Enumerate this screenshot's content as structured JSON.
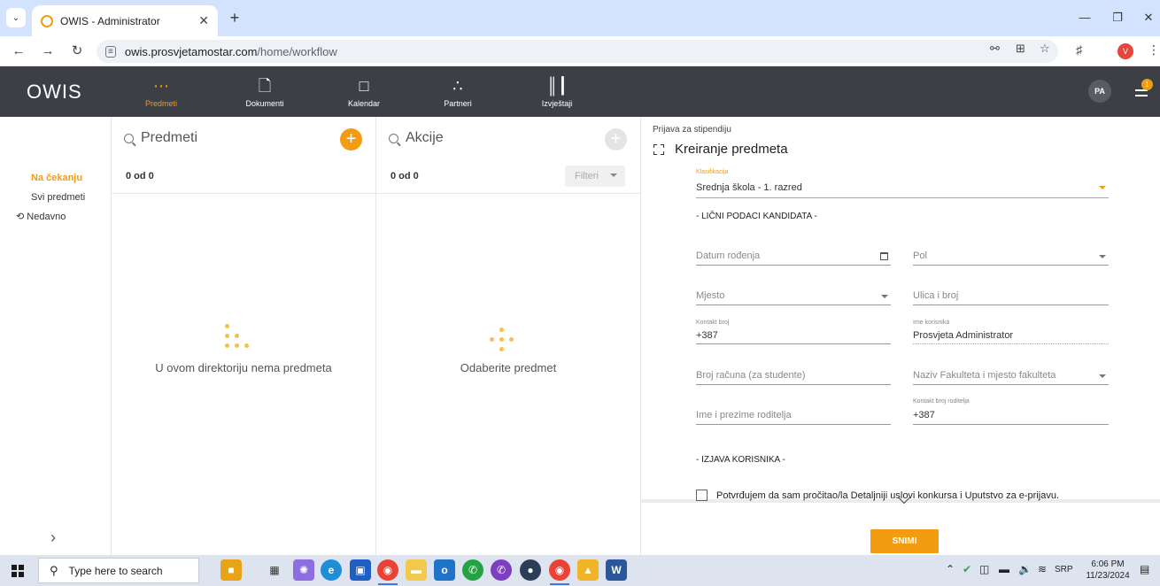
{
  "browser": {
    "tab_title": "OWIS - Administrator",
    "url_host": "owis.prosvjetamostar.com",
    "url_path": "/home/workflow",
    "profile_initial": "V"
  },
  "app": {
    "logo": "OWIS",
    "nav": [
      {
        "label": "Predmeti",
        "icon": "grid-dots-icon",
        "active": true
      },
      {
        "label": "Dokumenti",
        "icon": "document-icon",
        "active": false
      },
      {
        "label": "Kalendar",
        "icon": "calendar-icon",
        "active": false
      },
      {
        "label": "Partneri",
        "icon": "partners-icon",
        "active": false
      },
      {
        "label": "Izvještaji",
        "icon": "bar-chart-icon",
        "active": false
      }
    ],
    "user_initials": "PA",
    "notification_count": "1",
    "accent_color": "#f39c12"
  },
  "left_nav": {
    "items": [
      {
        "label": "Na čekanju",
        "active": true
      },
      {
        "label": "Svi predmeti",
        "active": false
      },
      {
        "label": "Nedavno",
        "active": false,
        "icon": "history-icon"
      }
    ],
    "expand_icon": "chevron-right-icon"
  },
  "predmeti_panel": {
    "title": "Predmeti",
    "count": "0 od 0",
    "empty_text": "U ovom direktoriju nema predmeta"
  },
  "akcije_panel": {
    "title": "Akcije",
    "count": "0 od 0",
    "filter_label": "Filteri",
    "empty_text": "Odaberite predmet"
  },
  "form": {
    "breadcrumb": "Prijava za stipendiju",
    "title": "Kreiranje predmeta",
    "klasifikacija_label": "Klasifikacija",
    "klasifikacija_value": "Srednja škola - 1. razred",
    "section_personal": "- LIČNI PODACI KANDIDATA -",
    "datum_rodjenja": "Datum rođenja",
    "pol": "Pol",
    "mjesto": "Mjesto",
    "ulica": "Ulica i broj",
    "kontakt_label": "Kontakt broj",
    "kontakt_value": "+387",
    "ime_korisnika_label": "Ime korisnika",
    "ime_korisnika_value": "Prosvjeta Administrator",
    "broj_racuna": "Broj računa (za studente)",
    "fakultet": "Naziv Fakulteta i mjesto fakulteta",
    "ime_roditelja": "Ime i prezime roditelja",
    "kontakt_roditelja_label": "Kontakt broj roditelja",
    "kontakt_roditelja_value": "+387",
    "section_izjava": "- IZJAVA KORISNIKA -",
    "confirm_text": "Potvrđujem da sam pročitao/la Detaljniji uslovi konkursa i Uputstvo za e-prijavu.",
    "save_label": "SNIMI"
  },
  "taskbar": {
    "search_placeholder": "Type here to search",
    "language": "SRP",
    "time": "6:06 PM",
    "date": "11/23/2024"
  }
}
